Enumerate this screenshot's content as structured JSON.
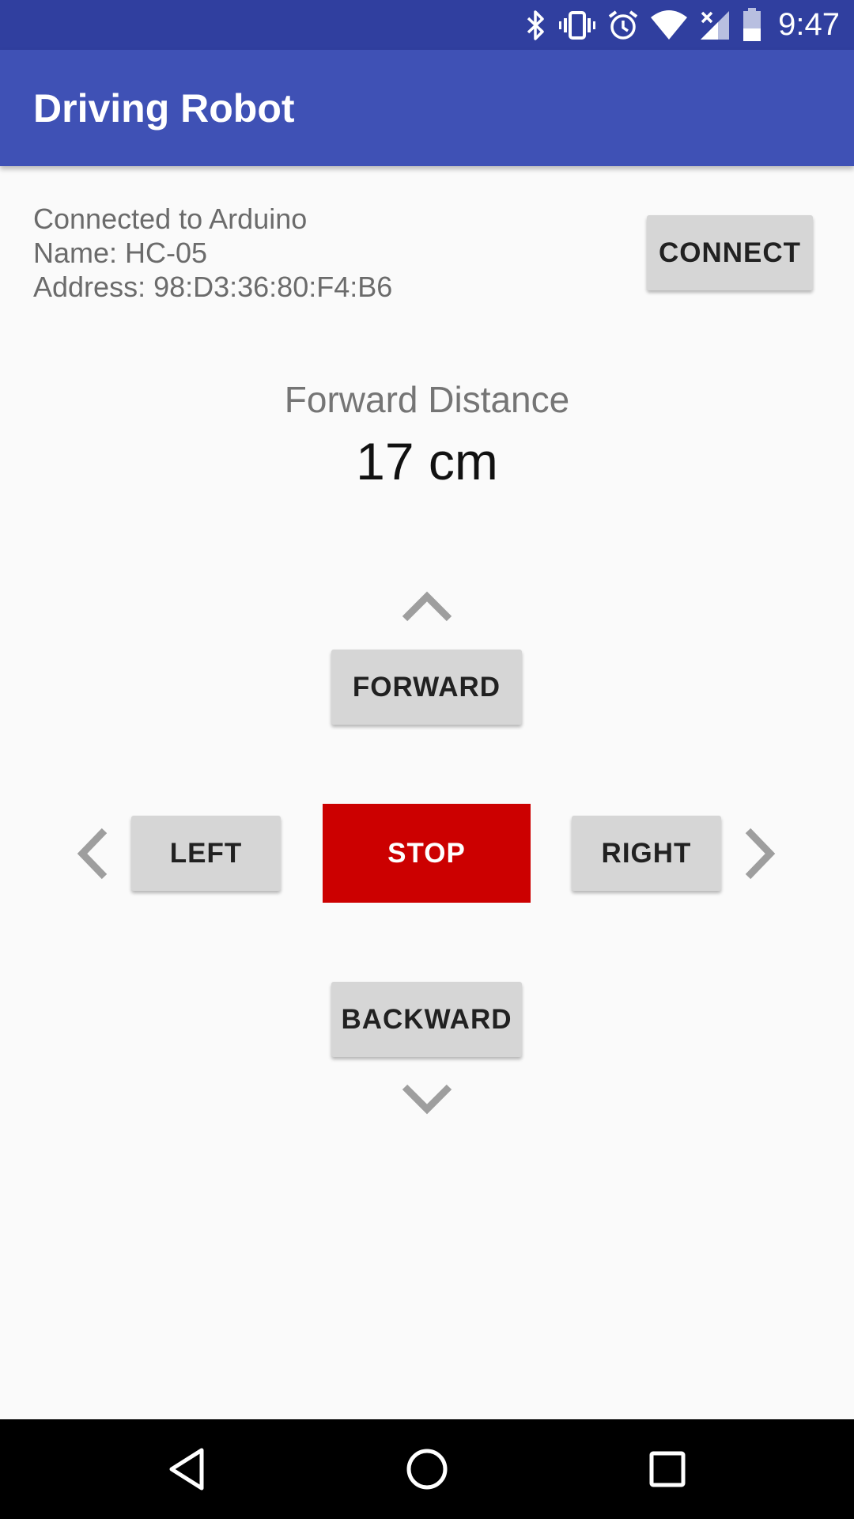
{
  "status_bar": {
    "time": "9:47",
    "icons": [
      "bluetooth-icon",
      "vibrate-icon",
      "alarm-icon",
      "wifi-icon",
      "cellular-no-signal-icon",
      "battery-icon"
    ]
  },
  "app_bar": {
    "title": "Driving Robot"
  },
  "connection": {
    "status": "Connected to Arduino",
    "name": "Name: HC-05",
    "address": "Address: 98:D3:36:80:F4:B6",
    "connect_label": "CONNECT"
  },
  "distance": {
    "label": "Forward Distance",
    "value": "17 cm"
  },
  "controls": {
    "forward_label": "FORWARD",
    "left_label": "LEFT",
    "stop_label": "STOP",
    "right_label": "RIGHT",
    "backward_label": "BACKWARD",
    "stop_color": "#cc0000"
  },
  "nav_bar": {
    "icons": [
      "back-icon",
      "home-icon",
      "recents-icon"
    ]
  },
  "colors": {
    "status_bar": "#303f9f",
    "app_bar": "#3f51b5",
    "button": "#d6d6d6",
    "arrow": "#9e9e9e"
  }
}
